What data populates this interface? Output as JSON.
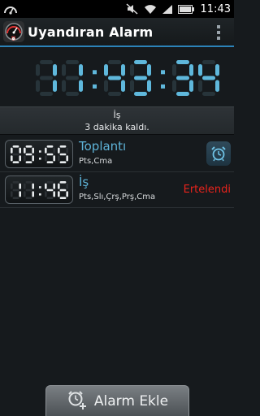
{
  "status_bar": {
    "time": "11:43",
    "icons": [
      "speedometer-icon",
      "mute-icon",
      "wifi-icon",
      "signal-icon",
      "battery-icon"
    ]
  },
  "action_bar": {
    "title": "Uyandıran Alarm",
    "app_icon": "alarm-gauge-icon",
    "overflow_icon": "overflow-menu-icon"
  },
  "clock": {
    "time": "11:43:34",
    "color": "#5fb8dc"
  },
  "next_alarm": {
    "line1": "İş",
    "line2": "3 dakika  kaldı."
  },
  "alarms": [
    {
      "time": "09:55",
      "label": "Toplantı",
      "days": "Pts,Cma",
      "state_icon": "alarm-clock-icon"
    },
    {
      "time": "11:46",
      "label": "İş",
      "days": "Pts,Slı,Çrş,Prş,Cma",
      "status": "Ertelendi"
    }
  ],
  "add_button": {
    "label": "Alarm Ekle",
    "icon": "add-alarm-icon"
  },
  "colors": {
    "accent": "#2c83b8",
    "label_blue": "#5eb3d8",
    "snoozed_red": "#e8231c"
  }
}
